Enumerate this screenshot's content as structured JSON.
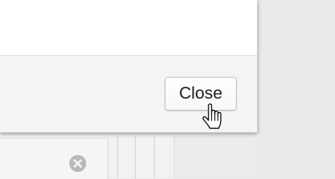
{
  "dialog": {
    "close_label": "Close"
  },
  "icons": {
    "list_remove": "close-circle-icon",
    "cursor": "hand-pointer-cursor"
  }
}
